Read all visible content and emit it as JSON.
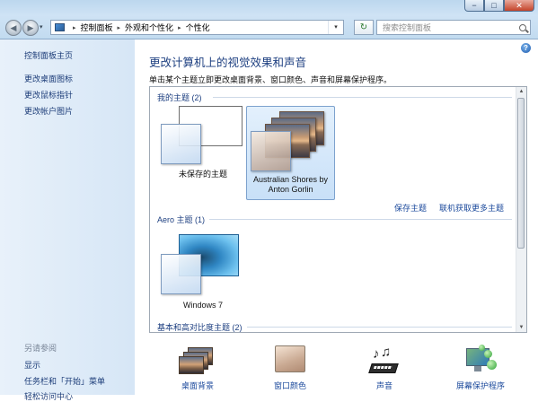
{
  "window": {
    "controls": {
      "minimize": "−",
      "maximize": "□",
      "close": "✕"
    }
  },
  "nav": {
    "back": "◀",
    "forward": "▶",
    "dropdown": "▾"
  },
  "address": {
    "crumbs": [
      "控制面板",
      "外观和个性化",
      "个性化"
    ],
    "separator": "▸",
    "dropdown": "▾"
  },
  "refresh_glyph": "↻",
  "search": {
    "placeholder": "搜索控制面板"
  },
  "sidebar": {
    "home": "控制面板主页",
    "items": [
      "更改桌面图标",
      "更改鼠标指针",
      "更改帐户图片"
    ],
    "see_also_title": "另请参阅",
    "see_also": [
      "显示",
      "任务栏和「开始」菜单",
      "轻松访问中心"
    ]
  },
  "main": {
    "help": "?",
    "title": "更改计算机上的视觉效果和声音",
    "subtitle": "单击某个主题立即更改桌面背景、窗口颜色、声音和屏幕保护程序。",
    "groups": {
      "my": "我的主题 (2)",
      "aero": "Aero 主题 (1)",
      "basic": "基本和高对比度主题 (2)"
    },
    "themes": {
      "unsaved": "未保存的主题",
      "australian_line1": "Australian Shores by",
      "australian_line2": "Anton Gorlin",
      "win7": "Windows 7"
    },
    "links": {
      "save": "保存主题",
      "online": "联机获取更多主题"
    }
  },
  "settings": {
    "desktop": "桌面背景",
    "color": "窗口颜色",
    "sound": "声音",
    "saver": "屏幕保护程序"
  },
  "colors": {
    "link": "#1c4a9c",
    "heading": "#1d3f80",
    "selection": "#c8e0f8"
  }
}
